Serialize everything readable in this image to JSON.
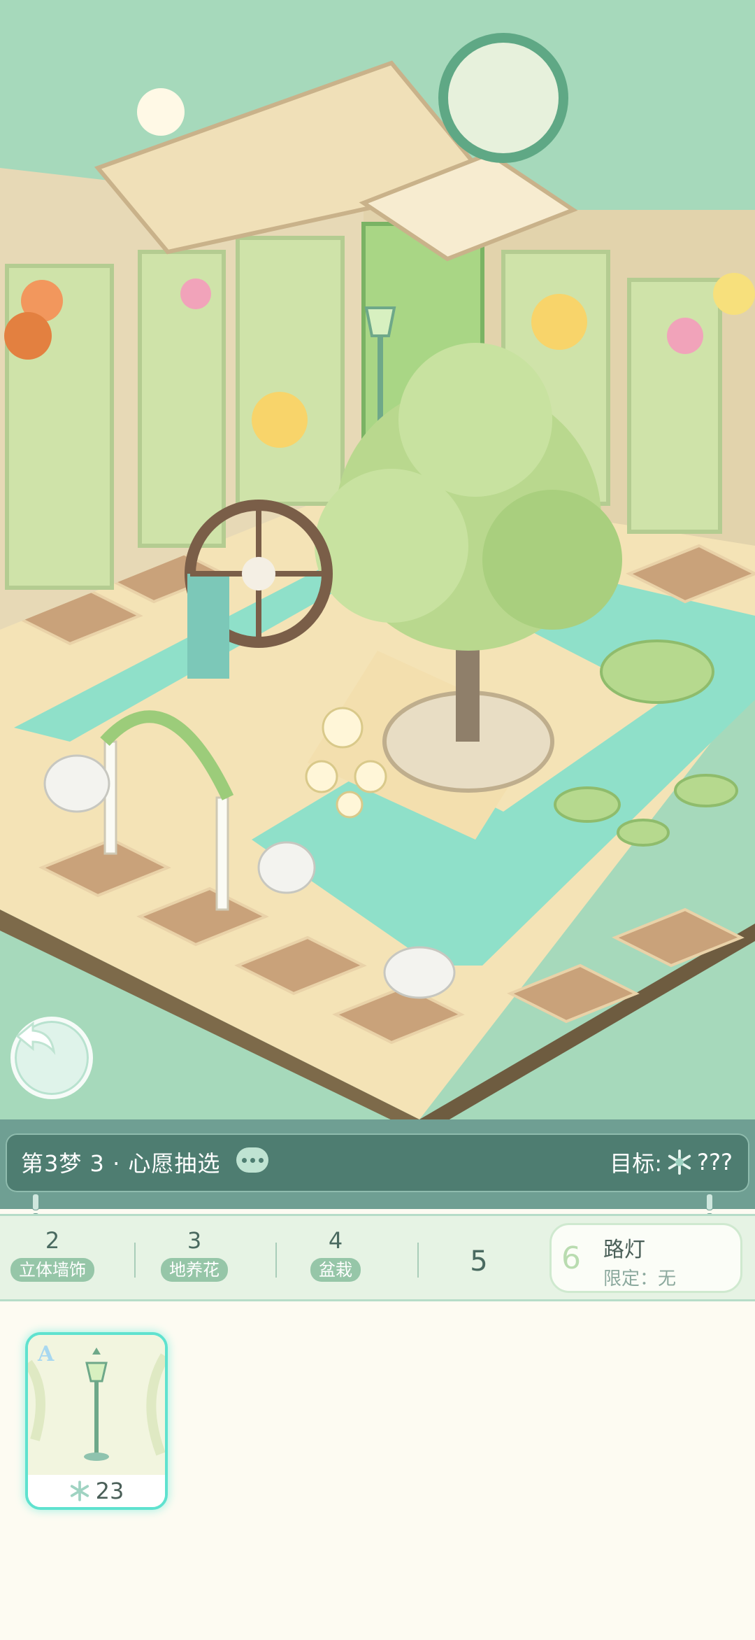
{
  "task": {
    "title": "第3梦 3 · 心愿抽选",
    "goal_label": "目标:",
    "goal_value": "???"
  },
  "categories": [
    {
      "number": "2",
      "label": "立体墙饰"
    },
    {
      "number": "3",
      "label": "地养花"
    },
    {
      "number": "4",
      "label": "盆栽"
    },
    {
      "number": "5"
    }
  ],
  "active_category": {
    "number": "6",
    "name": "路灯",
    "limit": "限定：无"
  },
  "items": [
    {
      "rank": "A",
      "cost": "23",
      "icon": "snowflake-icon",
      "name": "lamp-post"
    }
  ],
  "colors": {
    "scene_bg": "#a6d9bb",
    "water": "#8fe0c9",
    "taskbar": "#4e7d71",
    "card_glow": "#5fe2cf"
  }
}
